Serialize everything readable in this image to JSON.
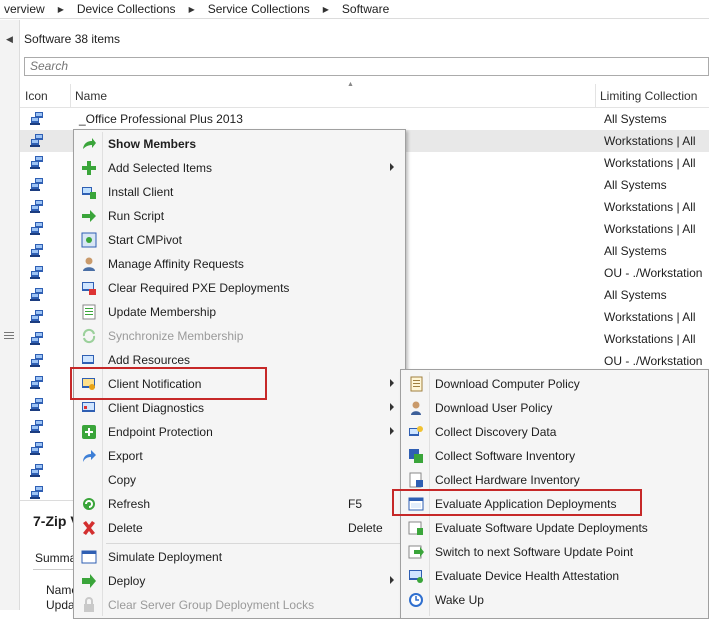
{
  "breadcrumb": [
    "verview",
    "Device Collections",
    "Service Collections",
    "Software"
  ],
  "panel_title": "Software 38 items",
  "search": {
    "placeholder": "Search",
    "value": ""
  },
  "columns": {
    "icon": "Icon",
    "name": "Name",
    "limiting": "Limiting Collection"
  },
  "rows": [
    {
      "name": "_Office Professional Plus 2013",
      "limiting": "All Systems"
    },
    {
      "name": "",
      "limiting": "Workstations | All"
    },
    {
      "name": "",
      "limiting": "Workstations | All"
    },
    {
      "name": "",
      "limiting": "All Systems"
    },
    {
      "name": "",
      "limiting": "Workstations | All"
    },
    {
      "name": "",
      "limiting": "Workstations | All"
    },
    {
      "name": "",
      "limiting": "All Systems"
    },
    {
      "name": "",
      "limiting": "OU - ./Workstation"
    },
    {
      "name": "",
      "limiting": "All Systems"
    },
    {
      "name": "",
      "limiting": "Workstations | All"
    },
    {
      "name": "",
      "limiting": "Workstations | All"
    },
    {
      "name": "",
      "limiting": "OU - ./Workstation"
    },
    {
      "name": "",
      "limiting": ""
    },
    {
      "name": "",
      "limiting": ""
    },
    {
      "name": "",
      "limiting": ""
    },
    {
      "name": "",
      "limiting": ""
    },
    {
      "name": "",
      "limiting": ""
    },
    {
      "name": "",
      "limiting": ""
    }
  ],
  "details": {
    "title": "7-Zip V",
    "tab": "Summa",
    "line1": "Name",
    "line2": "Upda"
  },
  "context_menu": {
    "items": [
      {
        "label": "Show Members",
        "icon": "arrow-green-icon"
      },
      {
        "label": "Add Selected Items",
        "icon": "plus-icon"
      },
      {
        "label": "Install Client",
        "icon": "install-icon"
      },
      {
        "label": "Run Script",
        "icon": "arrow-right-icon"
      },
      {
        "label": "Start CMPivot",
        "icon": "cmpivot-icon"
      },
      {
        "label": "Manage Affinity Requests",
        "icon": "user-icon"
      },
      {
        "label": "Clear Required PXE Deployments",
        "icon": "pxe-icon"
      },
      {
        "label": "Update Membership",
        "icon": "update-icon"
      },
      {
        "label": "Synchronize Membership",
        "icon": "sync-icon"
      },
      {
        "label": "Add Resources",
        "icon": "resources-icon"
      },
      {
        "label": "Client Notification",
        "icon": "notification-icon"
      },
      {
        "label": "Client Diagnostics",
        "icon": "diagnostics-icon"
      },
      {
        "label": "Endpoint Protection",
        "icon": "shield-icon"
      },
      {
        "label": "Export",
        "icon": "export-icon"
      },
      {
        "label": "Copy",
        "icon": "copy-icon"
      },
      {
        "label": "Refresh",
        "icon": "refresh-icon",
        "shortcut": "F5"
      },
      {
        "label": "Delete",
        "icon": "delete-icon",
        "shortcut": "Delete"
      },
      {
        "label": "Simulate Deployment",
        "icon": "simulate-icon"
      },
      {
        "label": "Deploy",
        "icon": "deploy-icon"
      },
      {
        "label": "Clear Server Group Deployment Locks",
        "icon": "locks-icon"
      }
    ]
  },
  "submenu": {
    "items": [
      {
        "label": "Download Computer Policy",
        "icon": "policy-icon"
      },
      {
        "label": "Download User Policy",
        "icon": "user-policy-icon"
      },
      {
        "label": "Collect Discovery Data",
        "icon": "discovery-icon"
      },
      {
        "label": "Collect Software Inventory",
        "icon": "software-inventory-icon"
      },
      {
        "label": "Collect Hardware Inventory",
        "icon": "hardware-inventory-icon"
      },
      {
        "label": "Evaluate Application Deployments",
        "icon": "app-deploy-icon"
      },
      {
        "label": "Evaluate Software Update Deployments",
        "icon": "update-deploy-icon"
      },
      {
        "label": "Switch to next Software Update Point",
        "icon": "switch-icon"
      },
      {
        "label": "Evaluate Device Health Attestation",
        "icon": "health-icon"
      },
      {
        "label": "Wake Up",
        "icon": "clock-icon"
      }
    ]
  }
}
